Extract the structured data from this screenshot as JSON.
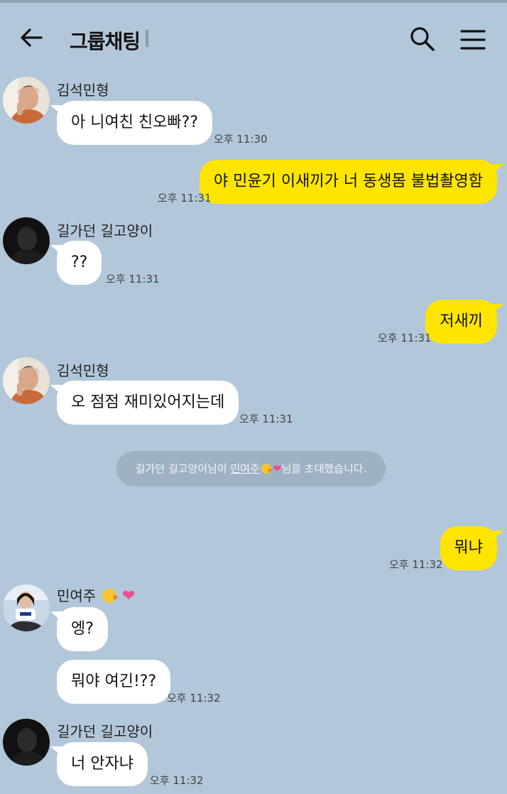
{
  "header": {
    "title": "그룹채팅",
    "back_icon": "arrow-left-icon",
    "search_icon": "search-icon",
    "menu_icon": "hamburger-menu-icon"
  },
  "colors": {
    "background": "#b2c7d9",
    "incoming_bubble": "#ffffff",
    "outgoing_bubble": "#fee500",
    "notice_bg": "#9fb2c4"
  },
  "senders": {
    "s1": "김석민형",
    "s2": "길가던 길고양이",
    "s3": "민여주"
  },
  "messages": [
    {
      "id": "m1",
      "text": "아 니여친 친오빠??",
      "time": "오후 11:30"
    },
    {
      "id": "m2",
      "text": "야 민윤기 이새끼가 너 동생몸 불법촬영함",
      "time": "오후 11:31"
    },
    {
      "id": "m3",
      "text": "??",
      "time": "오후 11:31"
    },
    {
      "id": "m4",
      "text": "저새끼",
      "time": "오후 11:31"
    },
    {
      "id": "m5",
      "text": "오 점점 재미있어지는데",
      "time": "오후 11:31"
    },
    {
      "id": "m6",
      "text": "뭐냐",
      "time": "오후 11:32"
    },
    {
      "id": "m7",
      "text": "엥?"
    },
    {
      "id": "m8",
      "text": "뭐야 여긴!??",
      "time": "오후 11:32"
    },
    {
      "id": "m9",
      "text": "너 안자냐",
      "time": "오후 11:32"
    }
  ],
  "notice": {
    "inviter": "길가던 길고양이님이",
    "invitee": "민여주",
    "suffix": "님을 초대했습니다."
  }
}
